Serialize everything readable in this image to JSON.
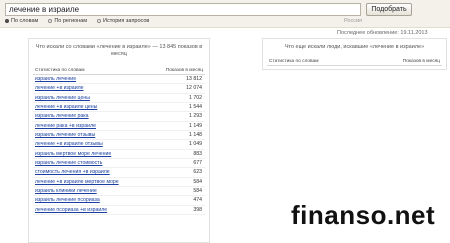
{
  "search": {
    "query": "лечение в израиле",
    "button_label": "Подобрать",
    "modes": [
      {
        "label": "По словам",
        "selected": true
      },
      {
        "label": "По регионам",
        "selected": false
      },
      {
        "label": "История запросов",
        "selected": false
      }
    ],
    "region": "Россия"
  },
  "updated": "Последнее обновление: 19.11.2013",
  "left_panel": {
    "title": "Что искали со словами «лечение в израиле» — 13 845 показов в месяц",
    "col_phrase": "Статистика по словам",
    "col_count": "Показов в месяц",
    "rows": [
      {
        "phrase": "израиль лечение",
        "count": "13 812"
      },
      {
        "phrase": "лечение +в израиле",
        "count": "12 074"
      },
      {
        "phrase": "израиль лечение цены",
        "count": "1 702"
      },
      {
        "phrase": "лечение +в израиле цены",
        "count": "1 544"
      },
      {
        "phrase": "израиль лечение рака",
        "count": "1 293"
      },
      {
        "phrase": "лечение рака +в израиле",
        "count": "1 149"
      },
      {
        "phrase": "израиль лечение отзывы",
        "count": "1 148"
      },
      {
        "phrase": "лечение +в израиле отзывы",
        "count": "1 049"
      },
      {
        "phrase": "израиль мертвое море лечение",
        "count": "883"
      },
      {
        "phrase": "израиль лечение стоимость",
        "count": "677"
      },
      {
        "phrase": "стоимость лечения +в израиле",
        "count": "623"
      },
      {
        "phrase": "лечение +в израиле мертвое море",
        "count": "584"
      },
      {
        "phrase": "израиль клиники лечение",
        "count": "584"
      },
      {
        "phrase": "израиль лечение псориаза",
        "count": "474"
      },
      {
        "phrase": "лечение псориаза +в израиле",
        "count": "398"
      }
    ]
  },
  "right_panel": {
    "title": "Что еще искали люди, искавшие «лечение в израиле»",
    "col_phrase": "Статистика по словам",
    "col_count": "Показов в месяц"
  },
  "watermark": "finanso.net"
}
